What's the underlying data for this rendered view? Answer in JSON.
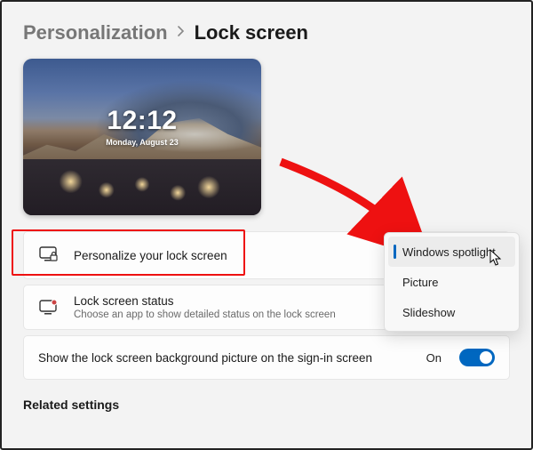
{
  "breadcrumb": {
    "parent": "Personalization",
    "current": "Lock screen"
  },
  "preview": {
    "time": "12:12",
    "date": "Monday, August 23"
  },
  "personalize": {
    "title": "Personalize your lock screen",
    "icon": "monitor-lock-icon"
  },
  "status": {
    "title": "Lock screen status",
    "subtitle": "Choose an app to show detailed status on the lock screen",
    "icon": "monitor-badge-icon"
  },
  "signin": {
    "label": "Show the lock screen background picture on the sign-in screen",
    "state_label": "On",
    "on": true
  },
  "dropdown": {
    "options": [
      "Windows spotlight",
      "Picture",
      "Slideshow"
    ],
    "selected": "Windows spotlight"
  },
  "related_heading": "Related settings",
  "colors": {
    "accent": "#0067c0",
    "highlight_annotation": "#e11"
  }
}
